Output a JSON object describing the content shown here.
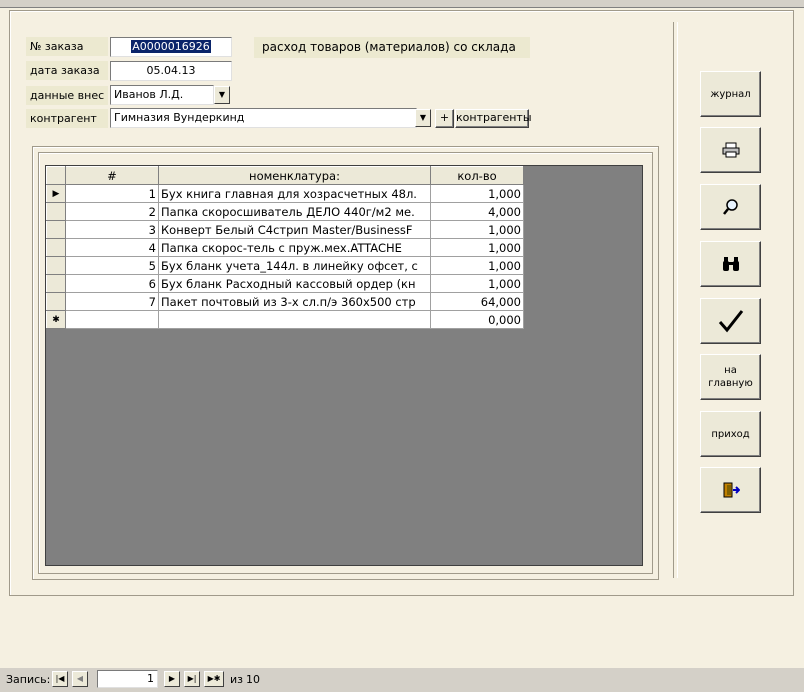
{
  "form": {
    "title": "расход товаров (материалов) со склада",
    "order_no_label": "№ заказа",
    "order_no_value": "A0000016926",
    "order_date_label": "дата заказа",
    "order_date_value": "05.04.13",
    "entered_by_label": "данные внес",
    "entered_by_value": "Иванов Л.Д.",
    "counterparty_label": "контрагент",
    "counterparty_value": "Гимназия Вундеркинд",
    "add_button": "+",
    "counterparties_button": "контрагенты"
  },
  "grid": {
    "headers": [
      "#",
      "номенклатура:",
      "кол-во"
    ],
    "rows": [
      {
        "n": "1",
        "name": "Бух книга главная для хозрасчетных 48л.",
        "qty": "1,000"
      },
      {
        "n": "2",
        "name": "Папка скоросшиватель ДЕЛО 440г/м2 ме.",
        "qty": "4,000"
      },
      {
        "n": "3",
        "name": "Конверт Белый С4стрип Master/BusinessF",
        "qty": "1,000"
      },
      {
        "n": "4",
        "name": "Папка скорос-тель с пруж.мех.ATTACHE",
        "qty": "1,000"
      },
      {
        "n": "5",
        "name": "Бух бланк учета_144л. в линейку офсет, с",
        "qty": "1,000"
      },
      {
        "n": "6",
        "name": "Бух бланк Расходный кассовый ордер (кн",
        "qty": "1,000"
      },
      {
        "n": "7",
        "name": "Пакет почтовый из 3-х сл.п/э 360х500 стр",
        "qty": "64,000"
      }
    ],
    "new_row_qty": "0,000",
    "current_marker": "▶",
    "new_marker": "✱"
  },
  "side": {
    "journal": "журнал",
    "to_main": "на главную",
    "income": "приход"
  },
  "statusbar": {
    "record_label": "Запись:",
    "current": "1",
    "of_label": "из",
    "total": "10"
  },
  "colors": {
    "form_bg": "#f5f0e1",
    "grid_bg": "#808080",
    "selection": "#0a246a"
  },
  "icons": [
    "print-icon",
    "zoom-icon",
    "binoculars-icon",
    "checkmark-icon",
    "exit-door-icon"
  ]
}
